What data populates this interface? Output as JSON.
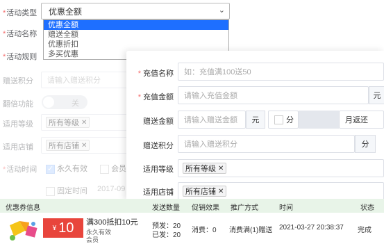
{
  "form": {
    "activity_type_label": "活动类型",
    "activity_type_value": "优惠全额",
    "activity_name_label": "活动名称",
    "activity_rule_label": "活动规则",
    "gift_points_label": "赠送积分",
    "gift_points_placeholder": "请输入赠送积分",
    "double_label": "翻倍功能",
    "double_state": "关",
    "level_label": "适用等级",
    "level_tag": "所有等级",
    "store_label": "适用店铺",
    "store_tag": "所有店铺",
    "time_label": "活动时间",
    "permanent_label": "永久有效",
    "member_label": "会员",
    "fixed_time_label": "固定时间",
    "date_partial": "2017-09"
  },
  "dropdown": {
    "options": [
      "优惠全额",
      "赠送全额",
      "优惠折扣",
      "多买优惠"
    ],
    "selected_index": 0
  },
  "panel": {
    "name_label": "充值名称",
    "name_placeholder": "如：充值满100送50",
    "amount_label": "充值金额",
    "amount_placeholder": "请输入充值金额",
    "amount_unit": "元",
    "gift_amount_label": "赠送金额",
    "gift_amount_placeholder": "请输入赠送金额",
    "gift_amount_unit": "元",
    "points_unit_inline": "分",
    "monthly_return": "月返还",
    "gift_points_label": "赠送积分",
    "gift_points_placeholder": "请输入赠送积分",
    "gift_points_unit": "分",
    "level_label": "适用等级",
    "level_tag": "所有等级",
    "store_label": "适用店铺",
    "store_tag": "所有店铺"
  },
  "table": {
    "headers": [
      "优惠券信息",
      "发送数量",
      "促销效果",
      "推广方式",
      "时间",
      "状态"
    ],
    "row": {
      "coupon_amount": "10",
      "coupon_currency": "¥",
      "coupon_title": "满300抵扣10元",
      "coupon_validity": "永久有效",
      "coupon_tag": "会员",
      "send_pre": "预发：20",
      "send_done": "已发：20",
      "effect": "消费：0",
      "promo": "消费满(1)赠送",
      "time": "2021-03-27 20:38:37",
      "status": "完成"
    }
  },
  "colors": {
    "accent": "#1e6fff",
    "required": "#f56c6c",
    "coupon_red": "#e8453c",
    "table_header_bg": "#e8f4e8"
  }
}
